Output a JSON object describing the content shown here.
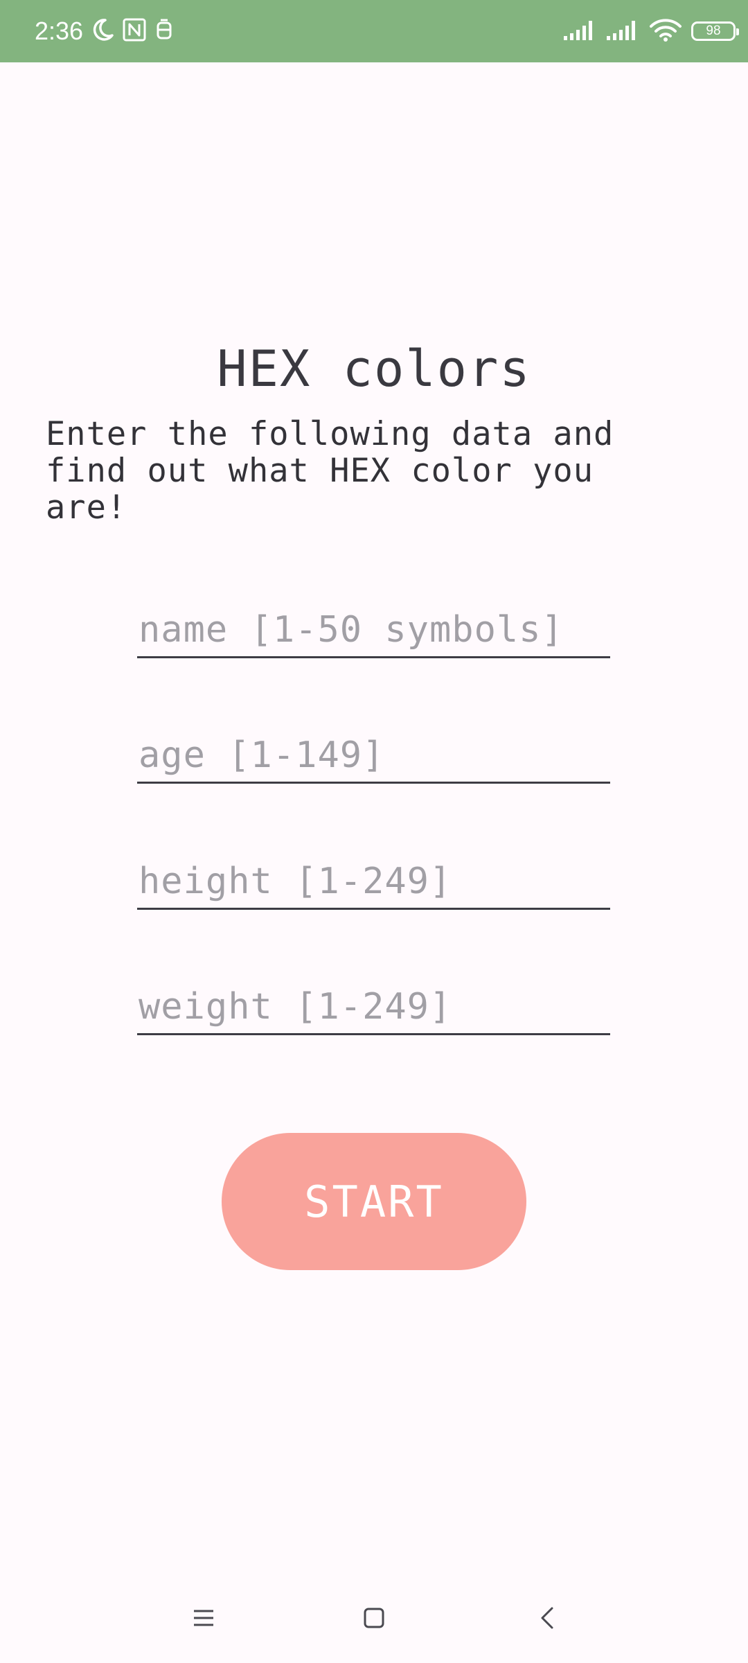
{
  "status_bar": {
    "time": "2:36",
    "battery": "98",
    "background_color": "#83b47f",
    "left_icons": [
      "moon-icon",
      "nfc-icon",
      "notification-icon"
    ],
    "right_icons": [
      "signal-icon",
      "signal-icon",
      "wifi-icon",
      "battery-icon"
    ]
  },
  "main": {
    "title": "HEX colors",
    "subtitle": "Enter the following data and find out what HEX color you are!",
    "fields": {
      "name": {
        "value": "",
        "placeholder": "name [1-50 symbols]"
      },
      "age": {
        "value": "",
        "placeholder": "age [1-149]"
      },
      "height": {
        "value": "",
        "placeholder": "height [1-249]"
      },
      "weight": {
        "value": "",
        "placeholder": "weight [1-249]"
      }
    },
    "start_label": "START",
    "button_color": "#f9a39b"
  },
  "nav_bar": {
    "icons": [
      "menu-icon",
      "home-icon",
      "back-icon"
    ]
  }
}
